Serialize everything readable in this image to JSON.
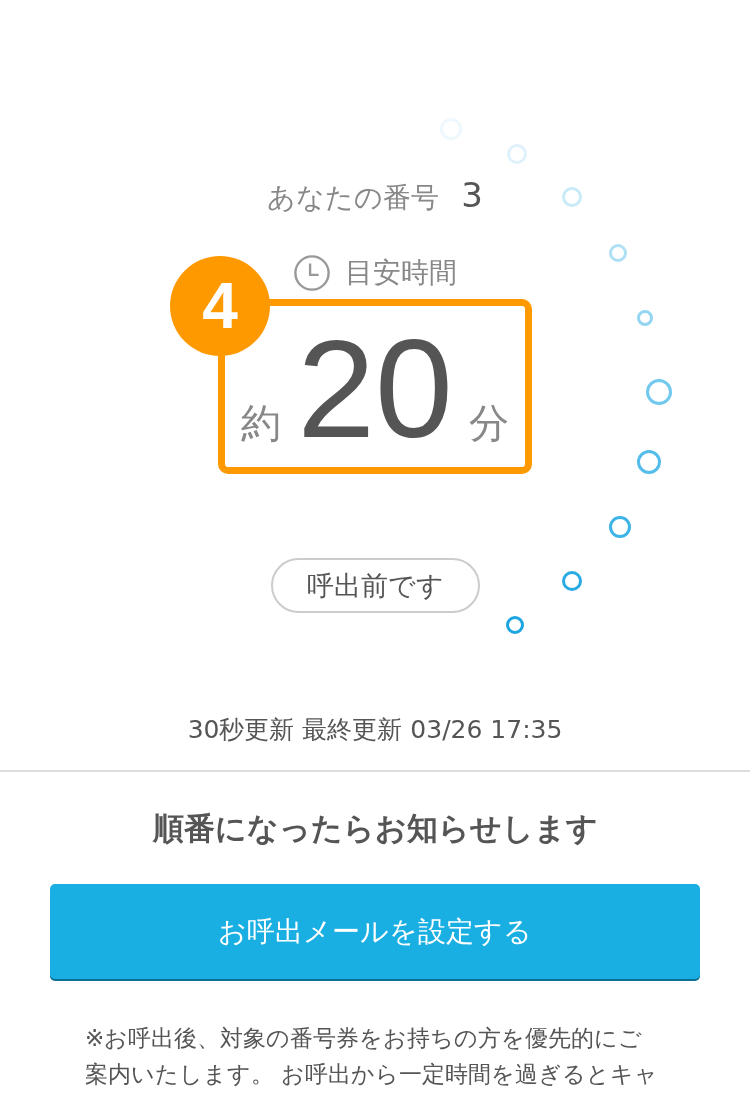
{
  "queue": {
    "your_number_label": "あなたの番号",
    "your_number": "3"
  },
  "estimate": {
    "badge": "4",
    "label": "目安時間",
    "prefix": "約",
    "minutes": "20",
    "unit": "分"
  },
  "status": "呼出前です",
  "update_info": "30秒更新 最終更新 03/26 17:35",
  "notify": {
    "heading": "順番になったらお知らせします",
    "button": "お呼出メールを設定する",
    "note": "※お呼出後、対象の番号券をお持ちの方を優先的にご案内いたします。 お呼出から一定時間を過ぎるとキャ"
  }
}
